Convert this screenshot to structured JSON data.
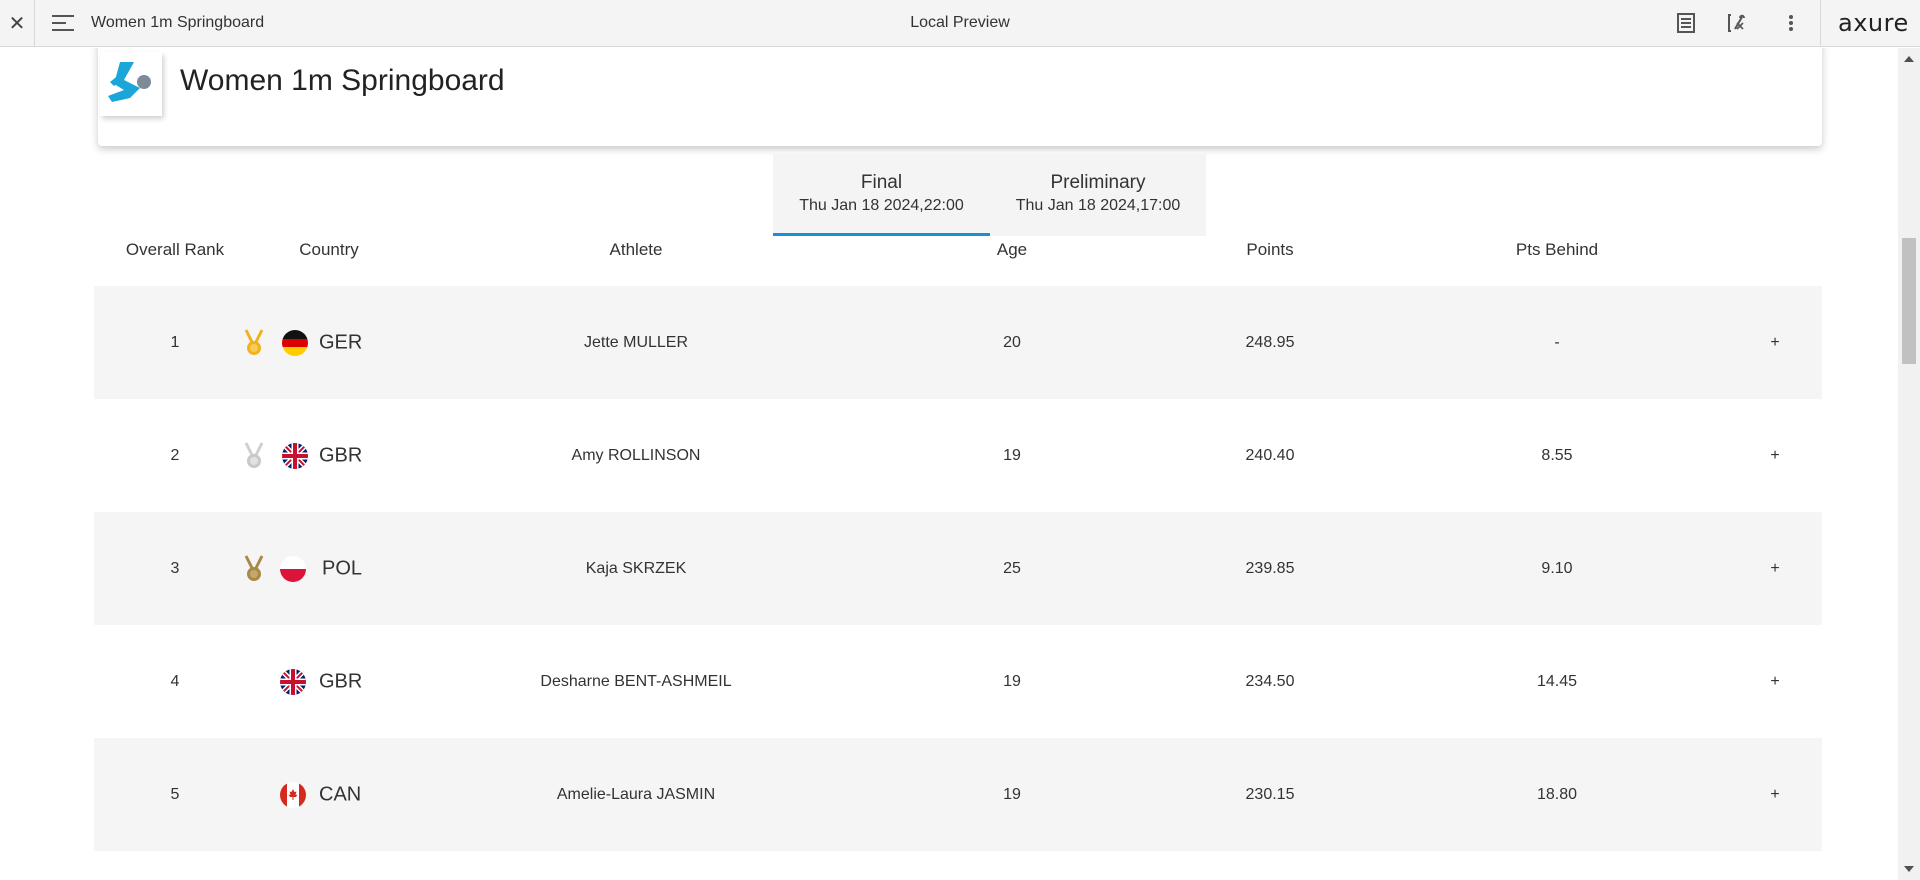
{
  "toolbar": {
    "close_icon": "close-icon",
    "menu_icon": "hamburger-menu-icon",
    "page_name": "Women 1m Springboard",
    "center_label": "Local Preview",
    "notes_icon": "notes-icon",
    "variables_icon": "variables-icon",
    "more_icon": "more-vertical-icon",
    "brand": "axure"
  },
  "header": {
    "title": "Women 1m Springboard",
    "logo_icon": "diving-logo-icon",
    "logo_color": "#1ba6d9"
  },
  "tabs": [
    {
      "name": "Final",
      "date": "Thu Jan 18 2024,22:00",
      "active": true
    },
    {
      "name": "Preliminary",
      "date": "Thu Jan 18 2024,17:00",
      "active": false
    }
  ],
  "table": {
    "columns": [
      "Overall Rank",
      "Country",
      "Athlete",
      "Age",
      "Points",
      "Pts Behind"
    ],
    "rows": [
      {
        "rank": "1",
        "medal": "gold",
        "country": "GER",
        "athlete": "Jette MULLER",
        "age": "20",
        "points": "248.95",
        "behind": "-",
        "expand": "+"
      },
      {
        "rank": "2",
        "medal": "silver",
        "country": "GBR",
        "athlete": "Amy ROLLINSON",
        "age": "19",
        "points": "240.40",
        "behind": "8.55",
        "expand": "+"
      },
      {
        "rank": "3",
        "medal": "bronze",
        "country": "POL",
        "athlete": "Kaja SKRZEK",
        "age": "25",
        "points": "239.85",
        "behind": "9.10",
        "expand": "+"
      },
      {
        "rank": "4",
        "medal": "",
        "country": "GBR",
        "athlete": "Desharne BENT-ASHMEIL",
        "age": "19",
        "points": "234.50",
        "behind": "14.45",
        "expand": "+"
      },
      {
        "rank": "5",
        "medal": "",
        "country": "CAN",
        "athlete": "Amelie-Laura JASMIN",
        "age": "19",
        "points": "230.15",
        "behind": "18.80",
        "expand": "+"
      }
    ]
  },
  "colors": {
    "accent": "#1b8fd6",
    "gold": "#f2b21c",
    "silver": "#c9c9c9",
    "bronze": "#a8894a"
  }
}
